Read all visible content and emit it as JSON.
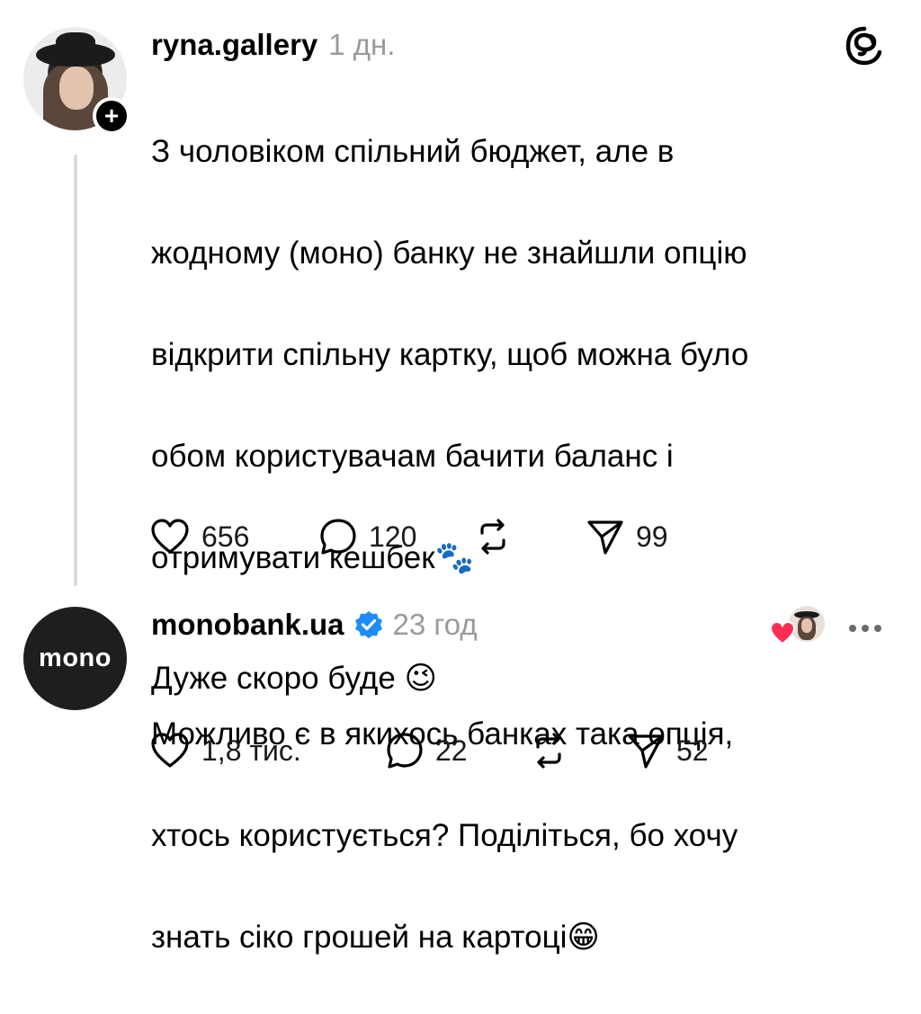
{
  "post1": {
    "username": "ryna.gallery",
    "time": "1 дн.",
    "paragraph1_lines": [
      "З чоловіком спільний бюджет, але в",
      "жодному (моно) банку не знайшли опцію",
      "відкрити спільну картку, щоб можна було",
      "обом користувачам бачити баланс і",
      "отримувати кешбек🐾"
    ],
    "paragraph2_lines": [
      "Можливо є в якихось банках така опція,",
      "хтось користується? Поділіться, бо хочу",
      "знать сіко грошей на картоці😁"
    ],
    "likes": "656",
    "replies": "120",
    "shares": "99",
    "icons": [
      "plus-icon",
      "threads-logo-icon",
      "heart-icon",
      "comment-icon",
      "repost-icon",
      "send-icon"
    ]
  },
  "post2": {
    "avatar_text": "mono",
    "username": "monobank.ua",
    "time": "23 год",
    "text": "Дуже скоро буде 😉",
    "likes": "1,8 тис.",
    "replies": "22",
    "shares": "52",
    "icons": [
      "verified-badge-icon",
      "heart-reaction-icon",
      "more-icon",
      "heart-icon",
      "comment-icon",
      "repost-icon",
      "send-icon"
    ]
  },
  "colors": {
    "text": "#000000",
    "muted": "#9a9a9a",
    "verified": "#1d8cf8",
    "heart": "#ff2d55"
  }
}
